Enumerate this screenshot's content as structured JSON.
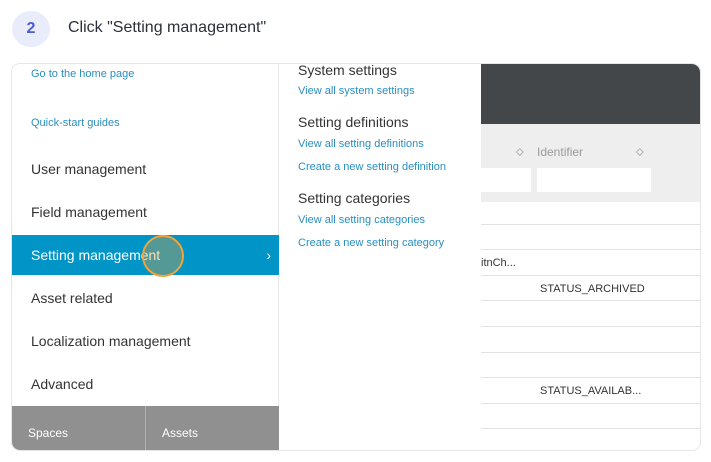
{
  "step": {
    "number": "2",
    "instruction": "Click \"Setting management\""
  },
  "menu": {
    "links": [
      {
        "label": "Go to the home page"
      },
      {
        "label": "Quick-start guides"
      }
    ],
    "items": [
      {
        "label": "User management",
        "active": false
      },
      {
        "label": "Field management",
        "active": false
      },
      {
        "label": "Setting management",
        "active": true
      },
      {
        "label": "Asset related",
        "active": false
      },
      {
        "label": "Localization management",
        "active": false
      },
      {
        "label": "Advanced",
        "active": false
      }
    ],
    "footer_tabs": [
      {
        "label": "Spaces"
      },
      {
        "label": "Assets"
      }
    ],
    "chevron_icon": "chevron-right-icon"
  },
  "submenu": {
    "sections": [
      {
        "heading": "System settings",
        "links": [
          "View all system settings"
        ]
      },
      {
        "heading": "Setting definitions",
        "links": [
          "View all setting definitions",
          "Create a new setting definition"
        ]
      },
      {
        "heading": "Setting categories",
        "links": [
          "View all setting categories",
          "Create a new setting category"
        ]
      }
    ]
  },
  "background_table": {
    "column_header": "Identifier",
    "cells": [
      "itnCh...",
      "STATUS_ARCHIVED",
      "STATUS_AVAILAB..."
    ]
  },
  "colors": {
    "active_item": "#0094c7",
    "link": "#2a8fc0",
    "topbar": "#434749",
    "click_indicator": "#f0a43a"
  }
}
